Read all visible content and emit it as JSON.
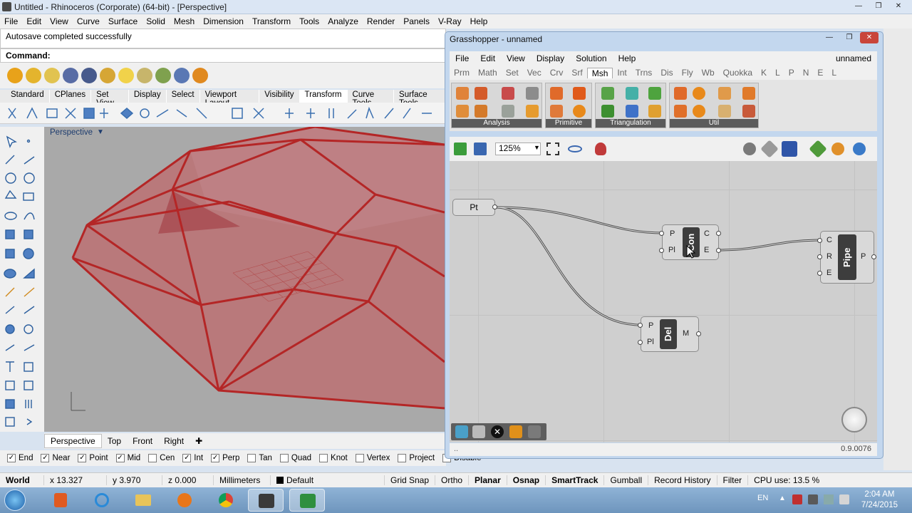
{
  "rhino": {
    "title": "Untitled - Rhinoceros (Corporate) (64-bit) - [Perspective]",
    "menu": [
      "File",
      "Edit",
      "View",
      "Curve",
      "Surface",
      "Solid",
      "Mesh",
      "Dimension",
      "Transform",
      "Tools",
      "Analyze",
      "Render",
      "Panels",
      "V-Ray",
      "Help"
    ],
    "history_text": "Autosave completed successfully",
    "command_label": "Command:",
    "toolbar_tabs": [
      "Standard",
      "CPlanes",
      "Set View",
      "Display",
      "Select",
      "Viewport Layout",
      "Visibility",
      "Transform",
      "Curve Tools",
      "Surface Tools"
    ],
    "active_toolbar_tab": "Transform",
    "viewport_label": "Perspective",
    "viewport_tabs": [
      "Perspective",
      "Top",
      "Front",
      "Right"
    ],
    "osnaps": [
      {
        "label": "End",
        "checked": true
      },
      {
        "label": "Near",
        "checked": true
      },
      {
        "label": "Point",
        "checked": true
      },
      {
        "label": "Mid",
        "checked": true
      },
      {
        "label": "Cen",
        "checked": false
      },
      {
        "label": "Int",
        "checked": true
      },
      {
        "label": "Perp",
        "checked": true
      },
      {
        "label": "Tan",
        "checked": false
      },
      {
        "label": "Quad",
        "checked": false
      },
      {
        "label": "Knot",
        "checked": false
      },
      {
        "label": "Vertex",
        "checked": false
      },
      {
        "label": "Project",
        "checked": false
      },
      {
        "label": "Disable",
        "checked": false
      }
    ],
    "status": {
      "cplane": "World",
      "x": "x 13.327",
      "y": "y 3.970",
      "z": "z 0.000",
      "units": "Millimeters",
      "layer": "Default",
      "grid_snap": "Grid Snap",
      "ortho": "Ortho",
      "planar": "Planar",
      "osnap": "Osnap",
      "smarttrack": "SmartTrack",
      "gumball": "Gumball",
      "record_history": "Record History",
      "filter": "Filter",
      "cpu": "CPU use: 13.5 %"
    }
  },
  "grasshopper": {
    "title": "Grasshopper - unnamed",
    "menu": [
      "File",
      "Edit",
      "View",
      "Display",
      "Solution",
      "Help"
    ],
    "document_name": "unnamed",
    "categories": [
      "Prm",
      "Math",
      "Set",
      "Vec",
      "Crv",
      "Srf",
      "Msh",
      "Int",
      "Trns",
      "Dis",
      "Fly",
      "Wb",
      "Quokka",
      "K",
      "L",
      "P",
      "N",
      "E",
      "L"
    ],
    "active_category": "Msh",
    "panels": [
      "Analysis",
      "Primitive",
      "Triangulation",
      "Util"
    ],
    "zoom": "125%",
    "version": "0.9.0076",
    "components": {
      "pt": {
        "label": "Pt"
      },
      "con": {
        "label": "Con",
        "inputs": [
          "P",
          "Pl"
        ],
        "outputs": [
          "C",
          "E"
        ]
      },
      "del": {
        "label": "Del",
        "inputs": [
          "P",
          "Pl"
        ],
        "outputs": [
          "M"
        ]
      },
      "pipe": {
        "label": "Pipe",
        "inputs": [
          "C",
          "R",
          "E"
        ],
        "outputs": [
          "P"
        ]
      }
    }
  },
  "taskbar": {
    "language": "EN",
    "time": "2:04 AM",
    "date": "7/24/2015"
  },
  "colors": {
    "mesh_red": "#b42626",
    "viewport_bg": "#a9a9a9",
    "gh_canvas": "#cfcfcf",
    "component_core": "#3d3d3d"
  }
}
